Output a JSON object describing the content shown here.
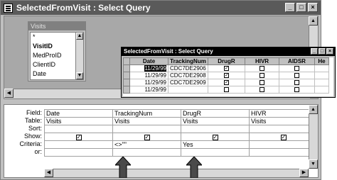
{
  "window": {
    "title": "SelectedFromVisit : Select Query"
  },
  "field_list": {
    "title": "Visits",
    "items": [
      "*",
      "VisitID",
      "MedProID",
      "ClientID",
      "Date"
    ]
  },
  "datasheet": {
    "title": "SelectedFromVisit : Select Query",
    "columns": [
      "Date",
      "TrackingNum",
      "DrugR",
      "HIVR",
      "AIDSR",
      "He"
    ],
    "rows": [
      {
        "date": "11/29/99",
        "tracking": "CDC7DE2906",
        "drugr": true,
        "hivr": false,
        "aidsr": false
      },
      {
        "date": "11/29/99",
        "tracking": "CDC7DE2908",
        "drugr": true,
        "hivr": false,
        "aidsr": false
      },
      {
        "date": "11/29/99",
        "tracking": "CDC7DE2909",
        "drugr": true,
        "hivr": false,
        "aidsr": false
      },
      {
        "date": "11/29/99",
        "tracking": "",
        "drugr": false,
        "hivr": false,
        "aidsr": false
      }
    ]
  },
  "qbe": {
    "row_labels": [
      "Field:",
      "Table:",
      "Sort:",
      "Show:",
      "Criteria:",
      "or:"
    ],
    "columns": [
      {
        "field": "Date",
        "table": "Visits",
        "sort": "",
        "show": true,
        "criteria": "",
        "or": ""
      },
      {
        "field": "TrackingNum",
        "table": "Visits",
        "sort": "",
        "show": true,
        "criteria": "<>\"\"",
        "or": ""
      },
      {
        "field": "DrugR",
        "table": "Visits",
        "sort": "",
        "show": true,
        "criteria": "Yes",
        "or": ""
      },
      {
        "field": "HIVR",
        "table": "Visits",
        "sort": "",
        "show": true,
        "criteria": "",
        "or": ""
      }
    ]
  },
  "icons": {
    "app": "query-window-icon",
    "minimize": "minimize-icon",
    "maximize": "maximize-icon",
    "close": "close-icon"
  }
}
